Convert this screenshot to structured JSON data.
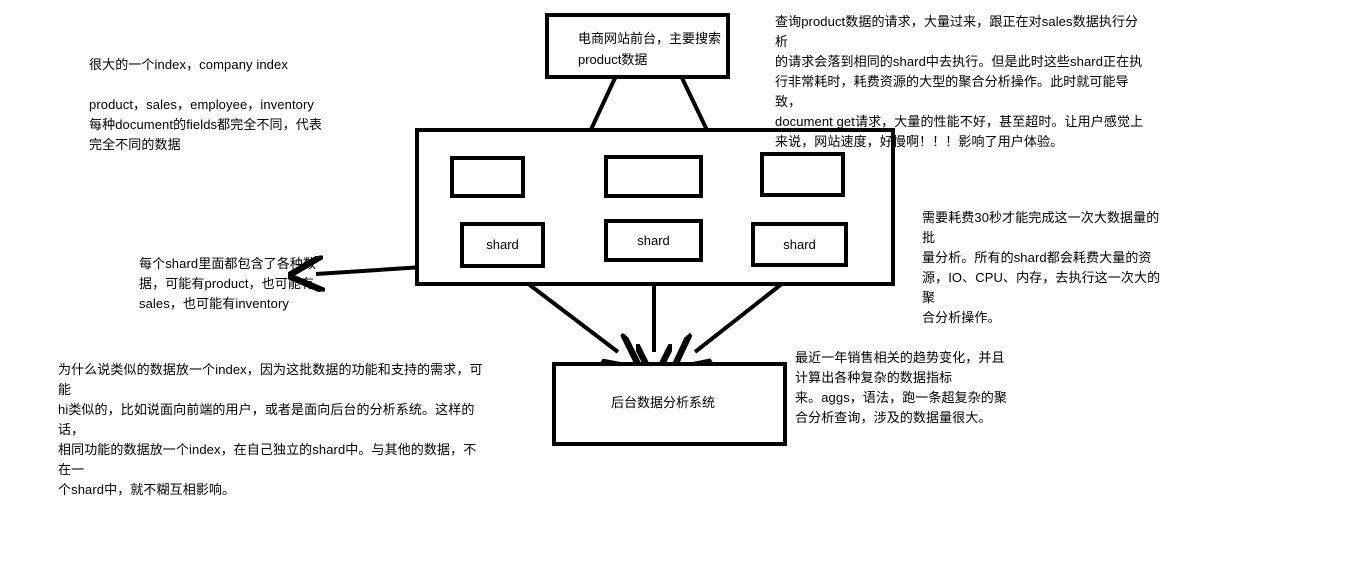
{
  "diagram": {
    "title_box": {
      "label": "电商网站前台，主要搜索\nproduct数据"
    },
    "cluster": {
      "shards": [
        {
          "label": "shard"
        },
        {
          "label": "shard"
        },
        {
          "label": "shard"
        }
      ],
      "empty_boxes": [
        {
          "label": ""
        },
        {
          "label": ""
        },
        {
          "label": ""
        }
      ]
    },
    "bottom_box": {
      "label": "后台数据分析系统"
    },
    "annotations": {
      "left_index": "很大的一个index，company index",
      "left_fields": "product，sales，employee，inventory\n每种document的fields都完全不同，代表\n完全不同的数据",
      "top_right": "查询product数据的请求，大量过来，跟正在对sales数据执行分析\n的请求会落到相同的shard中去执行。但是此时这些shard正在执\n行非常耗时，耗费资源的大型的聚合分析操作。此时就可能导致，\ndocument get请求，大量的性能不好，甚至超时。让用户感觉上\n来说，网站速度，好慢啊！！！影响了用户体验。",
      "left_shard_note": "每个shard里面都包含了各种数\n据，可能有product，也可能有\nsales，也可能有inventory",
      "right_cost_note": "需要耗费30秒才能完成这一次大数据量的批\n量分析。所有的shard都会耗费大量的资\n源，IO、CPU、内存，去执行这一次大的聚\n合分析操作。",
      "bottom_left": "为什么说类似的数据放一个index，因为这批数据的功能和支持的需求，可能\nhi类似的，比如说面向前端的用户，或者是面向后台的分析系统。这样的话，\n相同功能的数据放一个index，在自己独立的shard中。与其他的数据，不在一\n个shard中，就不糊互相影响。",
      "bottom_right": "最近一年销售相关的趋势变化，并且\n计算出各种复杂的数据指标\n来。aggs，语法，跑一条超复杂的聚\n合分析查询，涉及的数据量很大。"
    },
    "colors": {
      "stroke": "#000000",
      "background": "#ffffff",
      "text": "#000000"
    }
  }
}
